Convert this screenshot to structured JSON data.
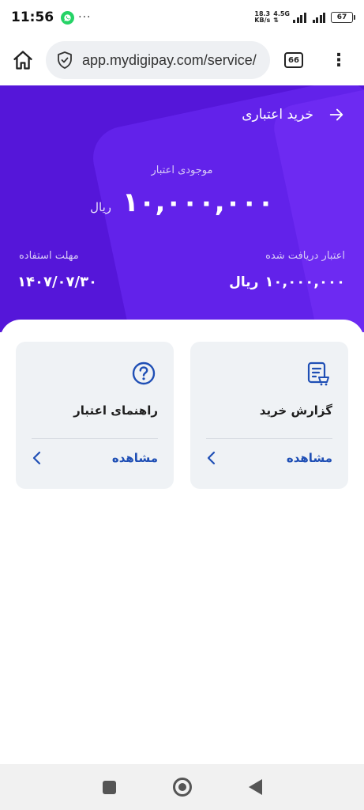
{
  "status_bar": {
    "time": "11:56",
    "dots": "···",
    "net_speed_value": "18.3",
    "net_speed_unit": "KB/s",
    "network_type": "4.5G",
    "battery": "67"
  },
  "browser": {
    "url": "app.mydigipay.com/service/",
    "tabs_count": "66",
    "menu": "⋮"
  },
  "header": {
    "title": "خرید اعتباری",
    "balance_label": "موجودی اعتبار",
    "balance_value": "۱۰,۰۰۰,۰۰۰",
    "balance_unit": "ریال",
    "received_label": "اعتبار دریافت شده",
    "received_value": "۱۰,۰۰۰,۰۰۰",
    "received_unit": "ریال",
    "deadline_label": "مهلت استفاده",
    "deadline_value": "۱۴۰۷/۰۷/۳۰"
  },
  "cards": [
    {
      "title": "گزارش خرید",
      "link": "مشاهده",
      "icon": "purchase-report-icon"
    },
    {
      "title": "راهنمای اعتبار",
      "link": "مشاهده",
      "icon": "help-icon"
    }
  ],
  "colors": {
    "hero_background": "#5516d9",
    "link": "#1f4fb5",
    "card_background": "#eff2f5"
  }
}
